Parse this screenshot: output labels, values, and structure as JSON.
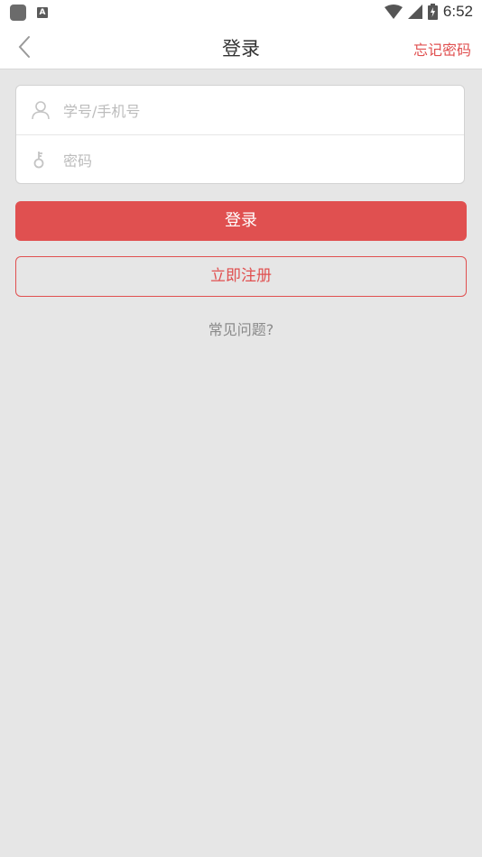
{
  "status_bar": {
    "time": "6:52",
    "left_icons": [
      "app-icon",
      "a-icon"
    ],
    "right_icons": [
      "wifi-icon",
      "signal-icon",
      "battery-icon"
    ]
  },
  "header": {
    "title": "登录",
    "back_icon": "chevron-left-icon",
    "forgot_label": "忘记密码"
  },
  "form": {
    "username": {
      "placeholder": "学号/手机号",
      "value": "",
      "icon": "user-icon"
    },
    "password": {
      "placeholder": "密码",
      "value": "",
      "icon": "key-icon"
    }
  },
  "buttons": {
    "login_label": "登录",
    "register_label": "立即注册"
  },
  "faq_label": "常见问题?",
  "colors": {
    "accent": "#e05050",
    "background": "#e6e6e6",
    "placeholder": "#bcbcbc",
    "muted_text": "#8a8a8a"
  }
}
